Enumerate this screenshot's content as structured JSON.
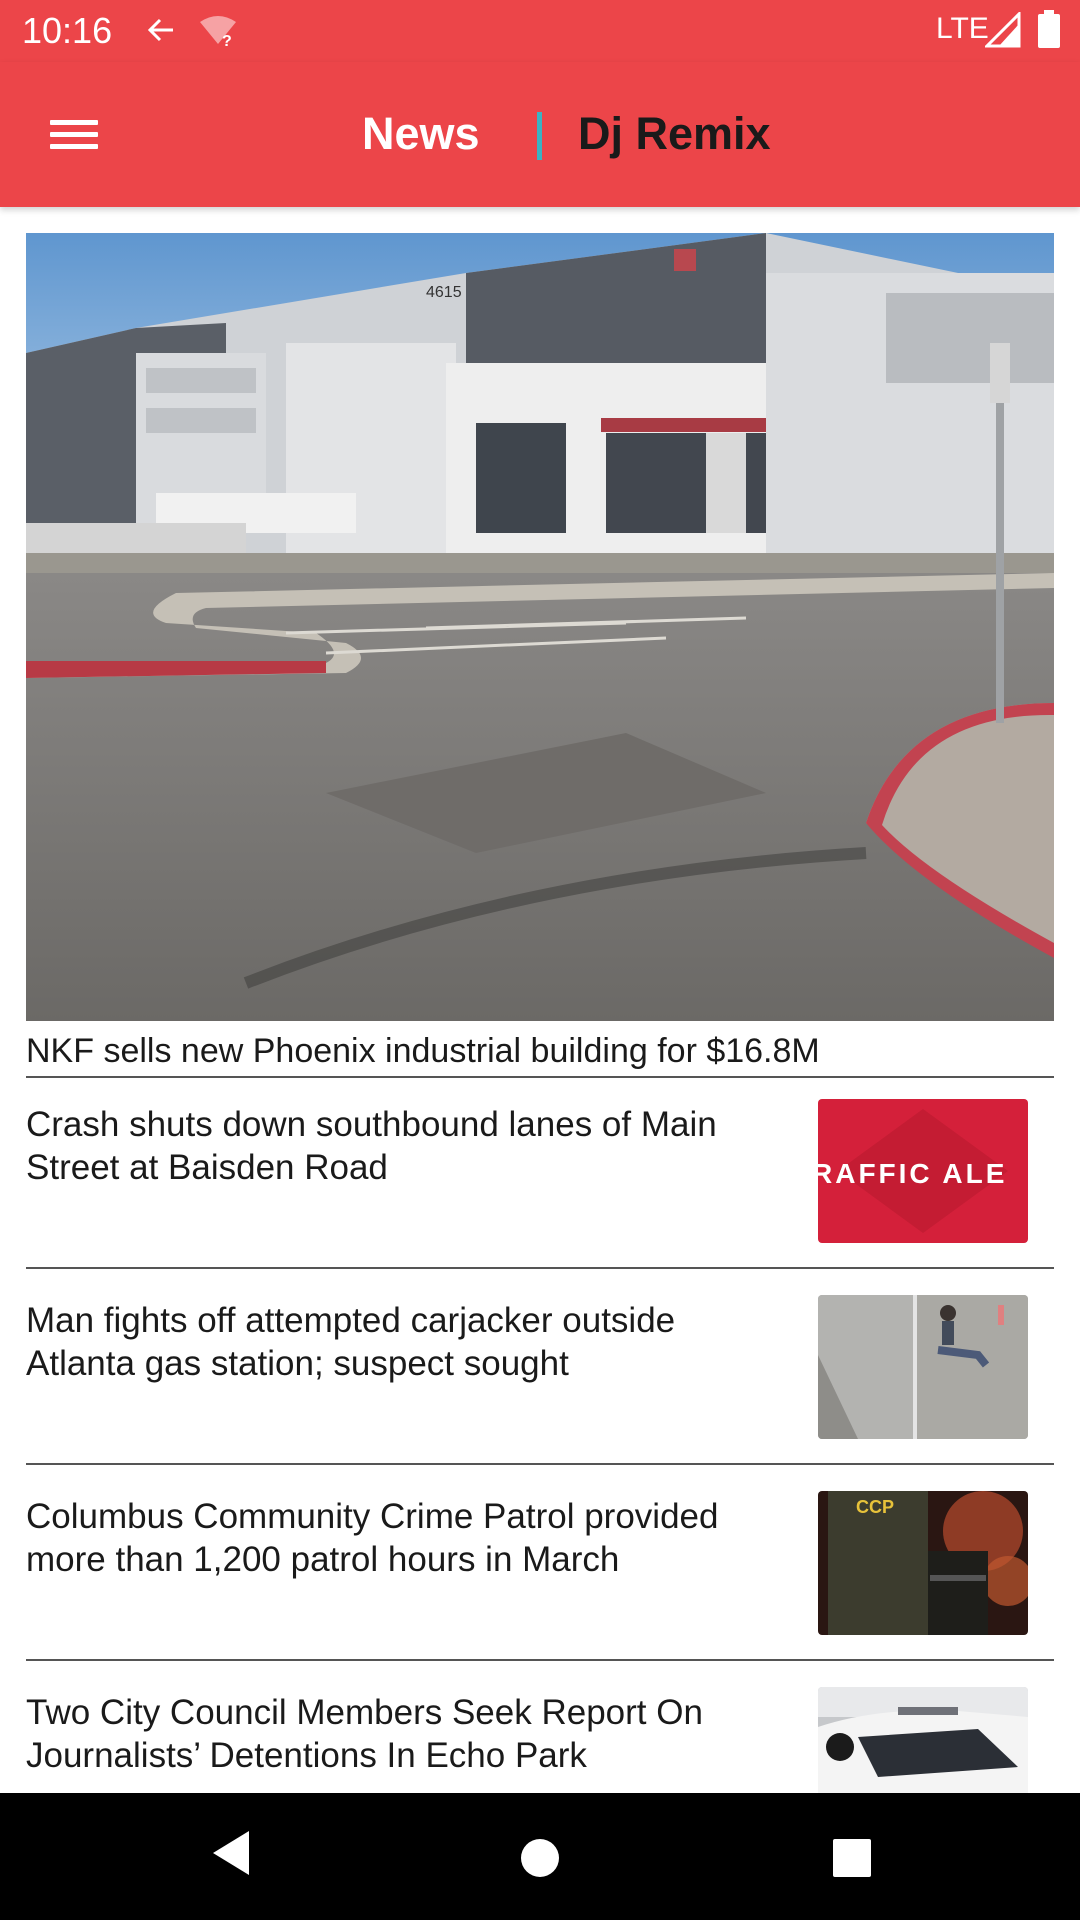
{
  "status_bar": {
    "time": "10:16",
    "network": "LTE",
    "icons": [
      "back-arrow-icon",
      "wifi-unknown-icon",
      "signal-icon",
      "battery-icon"
    ]
  },
  "app_bar": {
    "menu_icon": "hamburger-menu-icon",
    "tabs": [
      {
        "label": "News",
        "selected": true
      },
      {
        "label": "Dj Remix",
        "selected": false
      }
    ],
    "colors": {
      "background": "#ec4549",
      "divider": "#3bb3c3"
    }
  },
  "hero": {
    "title": "NKF sells new Phoenix industrial building for $16.8M",
    "image": "industrial-building-photo",
    "building_number": "4615"
  },
  "articles": [
    {
      "title": "Crash shuts down southbound lanes of Main Street at Baisden Road",
      "thumb": "traffic-alert-thumbnail",
      "thumb_text": "RAFFIC ALE"
    },
    {
      "title": "Man fights off attempted carjacker outside Atlanta gas station; suspect sought",
      "thumb": "surveillance-footage-thumbnail"
    },
    {
      "title": "Columbus Community Crime Patrol provided more than 1,200 patrol hours in March",
      "thumb": "patrol-officers-thumbnail",
      "thumb_text": "CCP"
    },
    {
      "title": "Two City Council Members Seek Report On Journalists’ Detentions In Echo Park",
      "thumb": "police-car-thumbnail"
    }
  ],
  "nav_bar": {
    "icons": [
      "back-triangle-icon",
      "home-circle-icon",
      "recents-square-icon"
    ]
  }
}
